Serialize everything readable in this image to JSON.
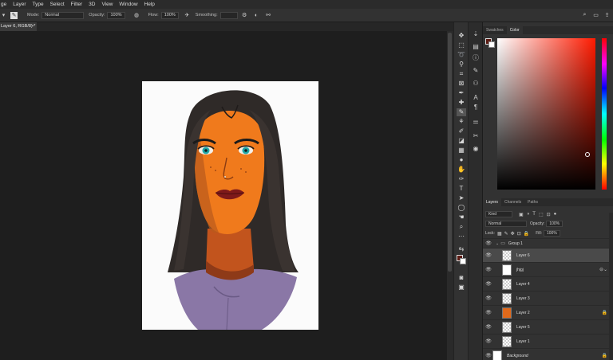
{
  "menu": [
    "ge",
    "Layer",
    "Type",
    "Select",
    "Filter",
    "3D",
    "View",
    "Window",
    "Help"
  ],
  "options": {
    "mode_label": "Mode:",
    "mode_value": "Normal",
    "opacity_label": "Opacity:",
    "opacity_value": "100%",
    "flow_label": "Flow:",
    "flow_value": "100%",
    "smoothing_label": "Smoothing:"
  },
  "document_tab": {
    "label": "Layer 6, RGB/8) *",
    "close": "×"
  },
  "color_panel": {
    "tabs": [
      "Swatches",
      "Color"
    ],
    "active_tab": "Color",
    "foreground": "#5b1a12",
    "background": "#ffffff"
  },
  "layers_panel": {
    "tabs": [
      "Layers",
      "Channels",
      "Paths"
    ],
    "active_tab": "Layers",
    "filter_value": "Kind",
    "blend_mode": "Normal",
    "opacity_label": "Opacity:",
    "opacity_value": "100%",
    "lock_label": "Lock:",
    "fill_label": "Fill:",
    "fill_value": "100%",
    "layers": [
      {
        "name": "Group 1",
        "type": "group"
      },
      {
        "name": "Layer 6",
        "type": "layer",
        "selected": true
      },
      {
        "name": "jhjgj",
        "type": "layer"
      },
      {
        "name": "Layer 4",
        "type": "layer"
      },
      {
        "name": "Layer 3",
        "type": "layer"
      },
      {
        "name": "Layer 2",
        "type": "layer"
      },
      {
        "name": "Layer 5",
        "type": "layer"
      },
      {
        "name": "Layer 1",
        "type": "layer"
      },
      {
        "name": "Background",
        "type": "background"
      }
    ]
  },
  "icons": [
    "brush-icon",
    "pressure-icon",
    "airbrush-icon",
    "search-icon",
    "workspace-icon",
    "share-icon",
    "eye-icon",
    "lock-icon",
    "folder-icon"
  ]
}
